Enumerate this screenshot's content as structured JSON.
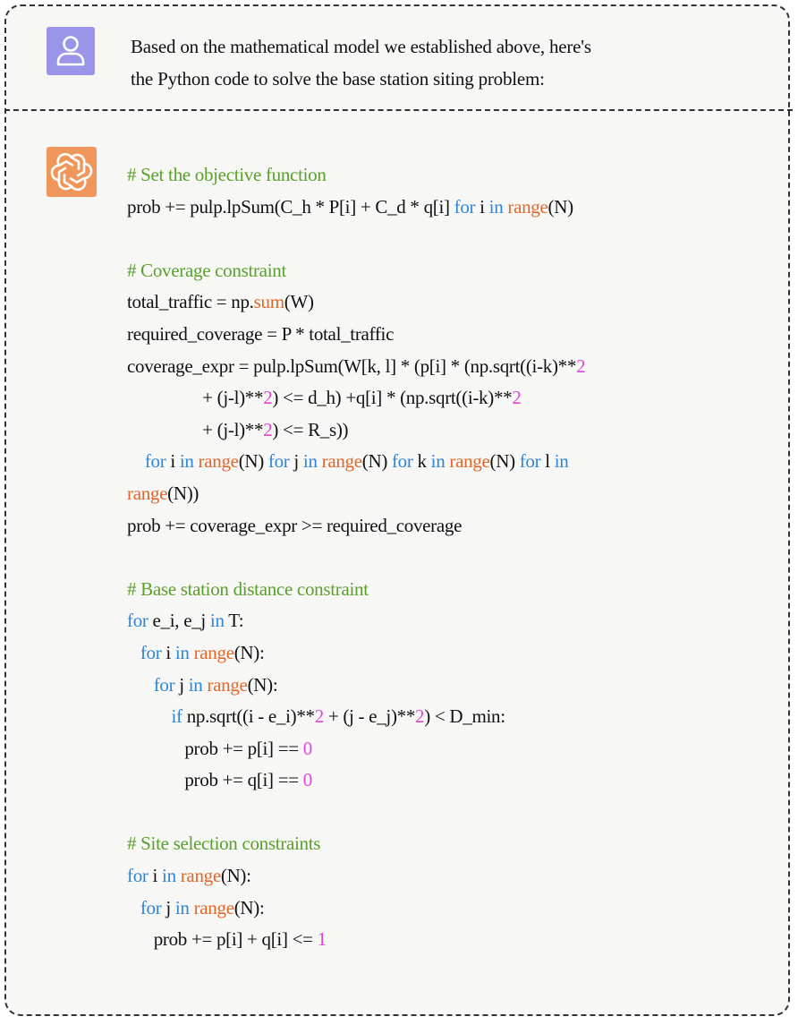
{
  "user": {
    "avatar_icon": "user-icon",
    "avatar_color": "#9b95ea",
    "message_line1": "Based on the mathematical model we established above, here's",
    "message_line2": "the Python code to solve the base station siting problem:"
  },
  "assistant": {
    "avatar_icon": "openai-logo-icon",
    "avatar_color": "#f0965a",
    "code": {
      "l01": "# Set the objective function",
      "l02a": "prob += pulp.lpSum(C_h * P[i] + C_d * q[i] ",
      "l02b": "for",
      "l02c": " i ",
      "l02d": "in",
      "l02e": " ",
      "l02f": "range",
      "l02g": "(N)",
      "l04": "# Coverage constraint",
      "l05a": "total_traffic = np.",
      "l05b": "sum",
      "l05c": "(W)",
      "l06": "required_coverage = P * total_traffic",
      "l07a": "coverage_expr = pulp.lpSum(W[k, l] * (p[i] * (np.sqrt((i-k)**",
      "l07b": "2",
      "l08a": "                 + (j-l)**",
      "l08b": "2",
      "l08c": ") <= d_h) +q[i] * (np.sqrt((i-k)**",
      "l08d": "2",
      "l09a": "                 + (j-l)**",
      "l09b": "2",
      "l09c": ") <= R_s))",
      "l10a": "    ",
      "l10b": "for",
      "l10c": " i ",
      "l10d": "in",
      "l10e": " ",
      "l10f": "range",
      "l10g": "(N) ",
      "l10h": "for",
      "l10i": " j ",
      "l10j": "in",
      "l10k": " ",
      "l10l": "range",
      "l10m": "(N) ",
      "l10n": "for",
      "l10o": " k ",
      "l10p": "in",
      "l10q": " ",
      "l10r": "range",
      "l10s": "(N) ",
      "l10t": "for",
      "l10u": " l ",
      "l10v": "in",
      "l11a": "range",
      "l11b": "(N))",
      "l12": "prob += coverage_expr >= required_coverage",
      "l14": "# Base station distance constraint",
      "l15a": "for",
      "l15b": " e_i, e_j ",
      "l15c": "in",
      "l15d": " T:",
      "l16a": "   ",
      "l16b": "for",
      "l16c": " i ",
      "l16d": "in",
      "l16e": " ",
      "l16f": "range",
      "l16g": "(N):",
      "l17a": "      ",
      "l17b": "for",
      "l17c": " j ",
      "l17d": "in",
      "l17e": " ",
      "l17f": "range",
      "l17g": "(N):",
      "l18a": "          ",
      "l18b": "if",
      "l18c": " np.sqrt((i - e_i)**",
      "l18d": "2",
      "l18e": " + (j - e_j)**",
      "l18f": "2",
      "l18g": ") < D_min:",
      "l19a": "             prob += p[i] == ",
      "l19b": "0",
      "l20a": "             prob += q[i] == ",
      "l20b": "0",
      "l22": "# Site selection constraints",
      "l23a": "for",
      "l23b": " i ",
      "l23c": "in",
      "l23d": " ",
      "l23e": "range",
      "l23f": "(N):",
      "l24a": "   ",
      "l24b": "for",
      "l24c": " j ",
      "l24d": "in",
      "l24e": " ",
      "l24f": "range",
      "l24g": "(N):",
      "l25a": "      prob += p[i] + q[i] <= ",
      "l25b": "1"
    }
  }
}
